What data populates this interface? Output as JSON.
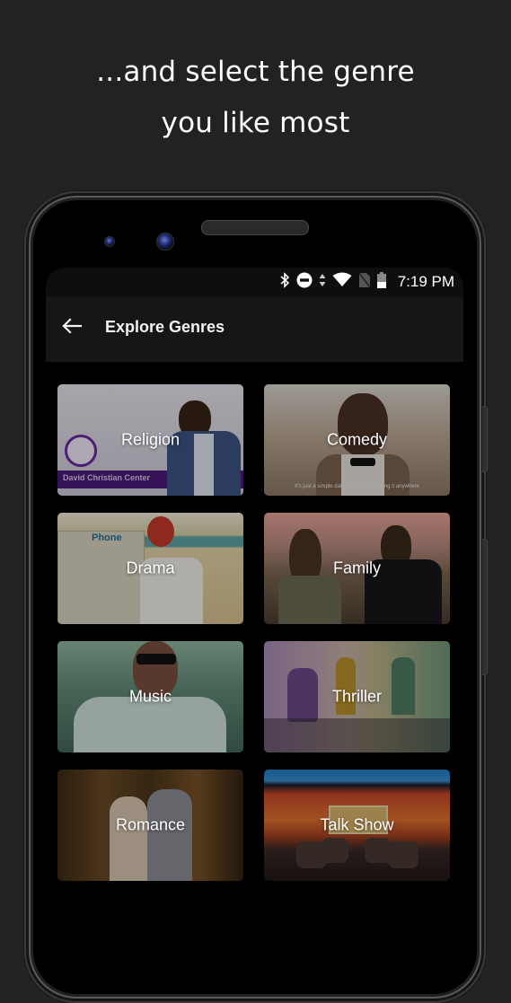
{
  "promo": {
    "line1": "...and select the genre",
    "line2": "you like most"
  },
  "status_bar": {
    "icons": [
      "bluetooth-icon",
      "do-not-disturb-icon",
      "data-arrows-icon",
      "wifi-icon",
      "no-sim-icon",
      "battery-icon"
    ],
    "time": "7:19 PM"
  },
  "app_bar": {
    "back_icon": "arrow-left-icon",
    "title": "Explore Genres"
  },
  "genres": [
    {
      "label": "Religion",
      "image_caption": "David Christian Center"
    },
    {
      "label": "Comedy",
      "image_caption": "It's just a simple date, not that I'm taking it anywhere"
    },
    {
      "label": "Drama",
      "image_caption": "Phone"
    },
    {
      "label": "Family"
    },
    {
      "label": "Music"
    },
    {
      "label": "Thriller"
    },
    {
      "label": "Romance"
    },
    {
      "label": "Talk Show"
    }
  ],
  "colors": {
    "page_background": "#222222",
    "screen_background": "#000000",
    "app_bar": "#161616",
    "status_bar": "#0e0e0e",
    "text": "#ffffff",
    "religion_banner": "#4b1a7a"
  }
}
